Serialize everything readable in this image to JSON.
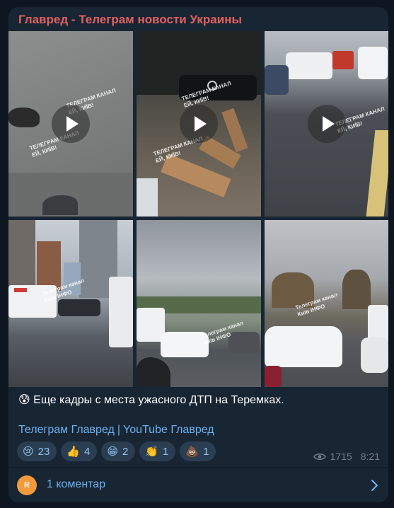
{
  "channel": {
    "name": "Главред - Телеграм новости Украины",
    "name_color": "#e06161"
  },
  "media": {
    "watermark_1": "ТЕЛЕГРАМ КАНАЛ",
    "watermark_2": "ЕЙ, КИЇВ!",
    "watermark_3": "Телеграм канал",
    "watermark_4": "Київ ІНФО"
  },
  "message": {
    "emoji": "😰",
    "text": "Еще кадры с места ужасного ДТП на Теремках.",
    "link_telegram": "Телеграм Главред",
    "link_separator": "|",
    "link_youtube": "YouTube Главред"
  },
  "reactions": [
    {
      "emoji": "😢",
      "count": "23"
    },
    {
      "emoji": "👍",
      "count": "4"
    },
    {
      "emoji": "😁",
      "count": "2"
    },
    {
      "emoji": "👏",
      "count": "1"
    },
    {
      "emoji": "💩",
      "count": "1"
    }
  ],
  "meta": {
    "views": "1715",
    "time": "8:21"
  },
  "comments": {
    "avatar_letter": "R",
    "label": "1 коментар"
  },
  "colors": {
    "link": "#6ab3f3",
    "bubble": "#182533",
    "background": "#0e1621"
  }
}
